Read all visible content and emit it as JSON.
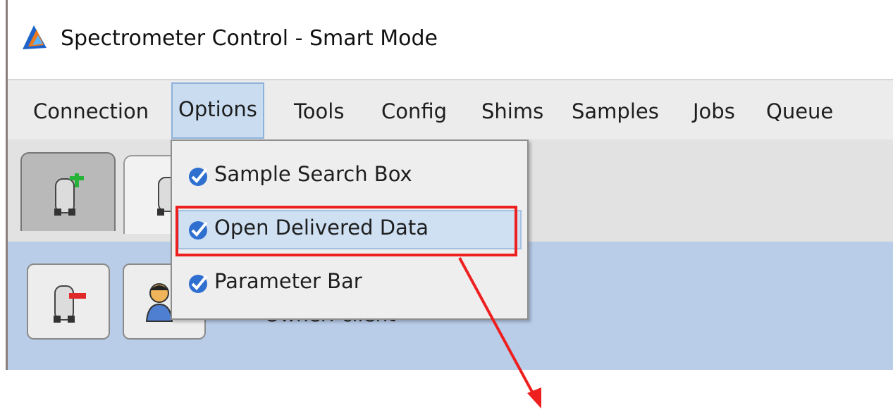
{
  "window": {
    "title": "Spectrometer Control - Smart Mode",
    "icon": "app-logo-icon"
  },
  "menubar": {
    "items": [
      {
        "label": "Connection"
      },
      {
        "label": "Options",
        "active": true
      },
      {
        "label": "Tools"
      },
      {
        "label": "Config"
      },
      {
        "label": "Shims"
      },
      {
        "label": "Samples"
      },
      {
        "label": "Jobs"
      },
      {
        "label": "Queue"
      }
    ]
  },
  "options_menu": {
    "items": [
      {
        "label": "Sample Search Box",
        "checked": true,
        "icon": "checkmark-icon"
      },
      {
        "label": "Open Delivered Data",
        "checked": true,
        "highlighted": true,
        "icon": "checkmark-icon"
      },
      {
        "label": "Parameter Bar",
        "checked": true,
        "icon": "checkmark-icon"
      }
    ]
  },
  "tabs": [
    {
      "icon": "add-sample-icon"
    },
    {
      "icon": "sample-icon"
    }
  ],
  "toolbar": {
    "buttons": [
      {
        "icon": "remove-sample-icon"
      },
      {
        "icon": "user-icon"
      }
    ]
  },
  "content": {
    "owner_text": "Owner: client"
  },
  "annotation": {
    "highlight_color": "#ee1f1f",
    "arrow_color": "#ee1f1f"
  },
  "colors": {
    "menu_active_bg": "#c9dcf0",
    "content_bg": "#b9cde9",
    "check_blue": "#2f6fd0"
  }
}
